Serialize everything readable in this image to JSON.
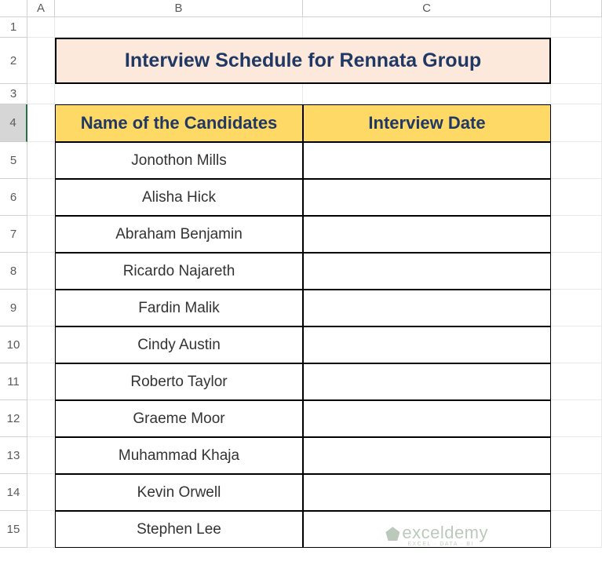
{
  "columns": [
    "A",
    "B",
    "C"
  ],
  "rows": [
    "1",
    "2",
    "3",
    "4",
    "5",
    "6",
    "7",
    "8",
    "9",
    "10",
    "11",
    "12",
    "13",
    "14",
    "15"
  ],
  "selectedRow": 4,
  "title": "Interview Schedule for Rennata Group",
  "headers": {
    "name": "Name of the Candidates",
    "date": "Interview Date"
  },
  "candidates": [
    "Jonothon Mills",
    "Alisha Hick",
    "Abraham Benjamin",
    "Ricardo Najareth",
    "Fardin Malik",
    "Cindy Austin",
    "Roberto Taylor",
    "Graeme Moor",
    "Muhammad Khaja",
    "Kevin Orwell",
    "Stephen Lee"
  ],
  "watermark": {
    "main": "exceldemy",
    "sub": "EXCEL · DATA · BI"
  }
}
